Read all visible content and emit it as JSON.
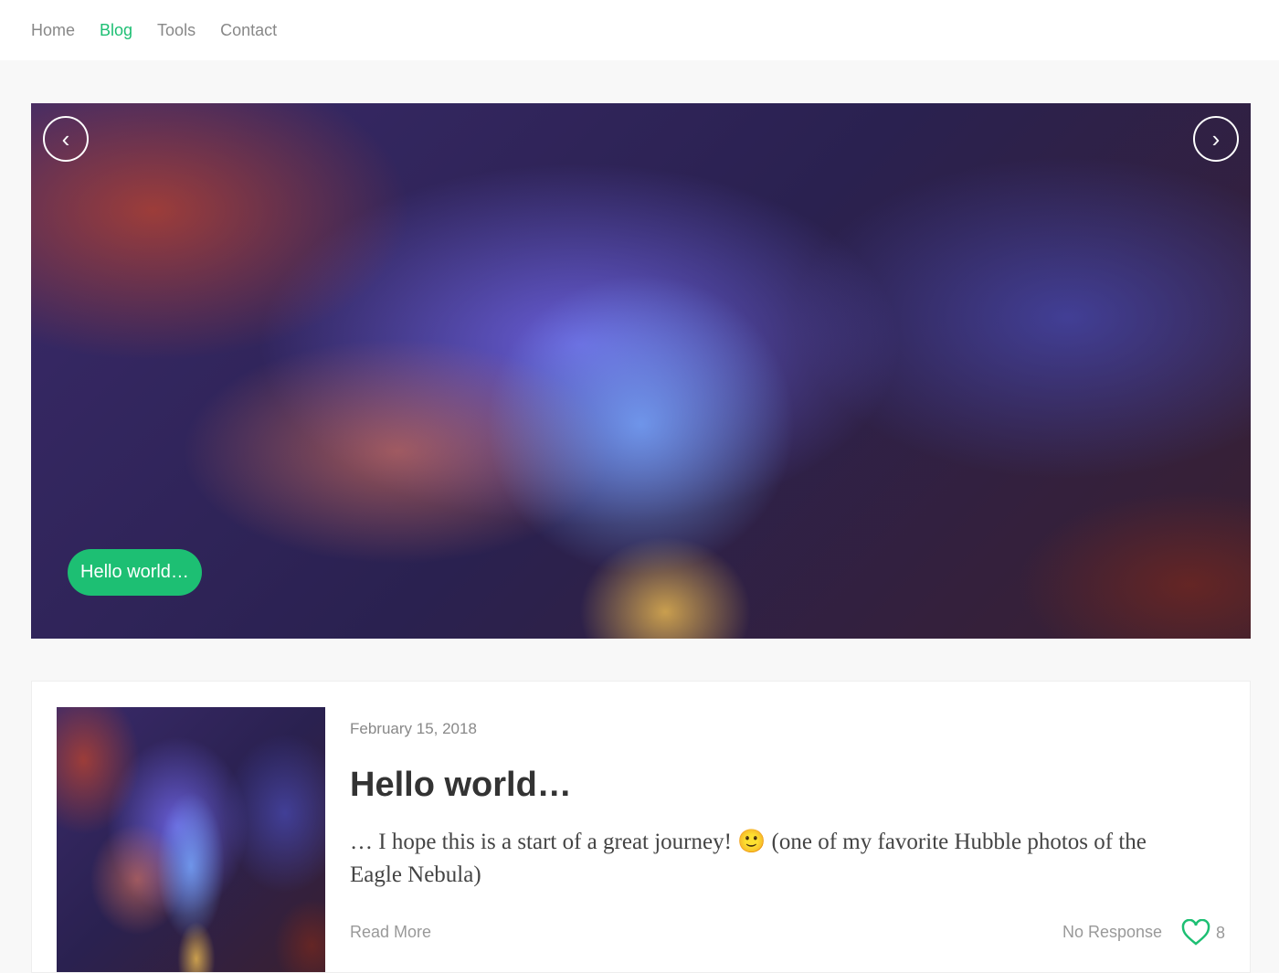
{
  "nav": {
    "items": [
      {
        "label": "Home"
      },
      {
        "label": "Blog",
        "active": true
      },
      {
        "label": "Tools"
      },
      {
        "label": "Contact"
      }
    ]
  },
  "slider": {
    "prev_icon": "chevron-left-icon",
    "next_icon": "chevron-right-icon",
    "caption": "Hello world…",
    "prev": "‹",
    "next": "›"
  },
  "post": {
    "date": "February 15, 2018",
    "title": "Hello world…",
    "excerpt": "… I hope this is a start of a great journey! 🙂 (one of my favorite Hubble photos of the Eagle Nebula)",
    "read_more": "Read More",
    "responses": "No Response",
    "likes": "8"
  },
  "colors": {
    "accent": "#1dbf73"
  }
}
